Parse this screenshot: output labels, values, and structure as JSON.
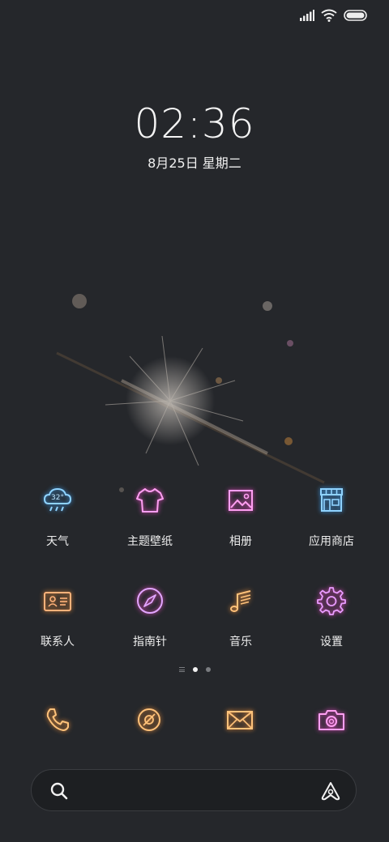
{
  "clock": {
    "time": "02:36",
    "date": "8月25日 星期二"
  },
  "status_bar": {
    "icons": [
      "signal-icon",
      "wifi-icon",
      "battery-icon"
    ]
  },
  "apps_row1": [
    {
      "label": "天气",
      "icon": "weather-icon",
      "badge": "32°"
    },
    {
      "label": "主题壁纸",
      "icon": "tshirt-icon"
    },
    {
      "label": "相册",
      "icon": "gallery-icon"
    },
    {
      "label": "应用商店",
      "icon": "store-icon"
    }
  ],
  "apps_row2": [
    {
      "label": "联系人",
      "icon": "contacts-icon"
    },
    {
      "label": "指南针",
      "icon": "compass-icon"
    },
    {
      "label": "音乐",
      "icon": "music-icon"
    },
    {
      "label": "设置",
      "icon": "gear-icon"
    }
  ],
  "page_indicator": {
    "pages": 3,
    "active": 1
  },
  "dock": [
    "phone-icon",
    "browser-icon",
    "message-icon",
    "camera-icon"
  ],
  "search_bar": {
    "icons": [
      "search-icon",
      "assistant-icon"
    ]
  },
  "colors": {
    "background": "#25272b",
    "neon_blue": "#8fd3ff",
    "neon_pink": "#ff8ff0",
    "neon_orange": "#ffc27a",
    "neon_violet": "#d9a0ff"
  }
}
